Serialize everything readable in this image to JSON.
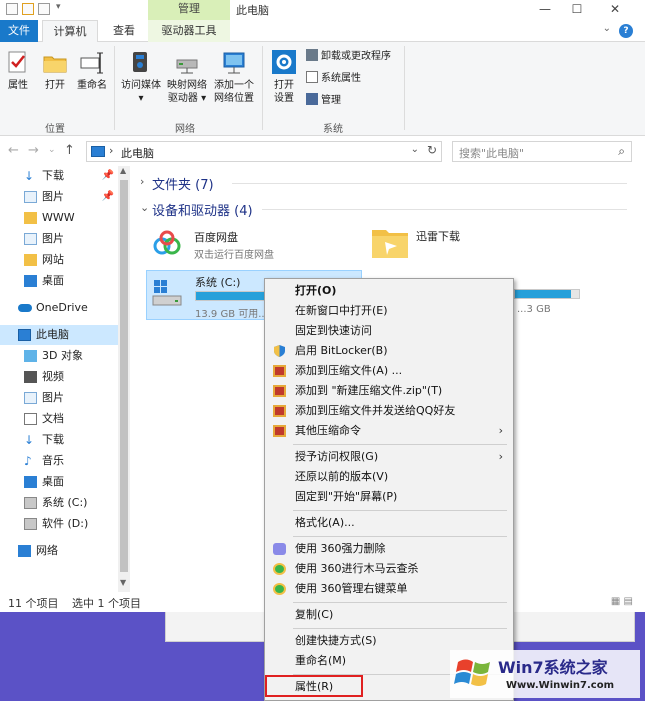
{
  "window": {
    "context_group": "管理",
    "title": "此电脑",
    "minimize": "—",
    "maximize": "☐",
    "close": "✕"
  },
  "tabs": {
    "file": "文件",
    "computer": "计算机",
    "view": "查看",
    "drive_tools": "驱动器工具",
    "help": "?"
  },
  "ribbon": {
    "location": {
      "label": "位置",
      "properties": "属性",
      "open": "打开",
      "rename": "重命名"
    },
    "network": {
      "label": "网络",
      "access_media_1": "访问媒体",
      "access_media_2": "▾",
      "map_drive_1": "映射网络",
      "map_drive_2": "驱动器 ▾",
      "add_location_1": "添加一个",
      "add_location_2": "网络位置"
    },
    "system": {
      "label": "系统",
      "open_settings_1": "打开",
      "open_settings_2": "设置",
      "uninstall": "卸载或更改程序",
      "system_props": "系统属性",
      "manage": "管理"
    }
  },
  "address": {
    "path": "此电脑",
    "search_placeholder": "搜索\"此电脑\""
  },
  "nav": {
    "items": [
      {
        "label": "下载",
        "pinned": true
      },
      {
        "label": "图片",
        "pinned": true
      },
      {
        "label": "WWW",
        "pinned": false
      },
      {
        "label": "图片",
        "pinned": false
      },
      {
        "label": "网站",
        "pinned": false
      },
      {
        "label": "桌面",
        "pinned": false
      },
      {
        "label": "OneDrive",
        "pinned": false
      },
      {
        "label": "此电脑",
        "pinned": false
      },
      {
        "label": "3D 对象",
        "pinned": false
      },
      {
        "label": "视频",
        "pinned": false
      },
      {
        "label": "图片",
        "pinned": false
      },
      {
        "label": "文档",
        "pinned": false
      },
      {
        "label": "下载",
        "pinned": false
      },
      {
        "label": "音乐",
        "pinned": false
      },
      {
        "label": "桌面",
        "pinned": false
      },
      {
        "label": "系统 (C:)",
        "pinned": false
      },
      {
        "label": "软件 (D:)",
        "pinned": false
      },
      {
        "label": "网络",
        "pinned": false
      }
    ]
  },
  "content": {
    "folders_header": "文件夹 (7)",
    "devices_header": "设备和驱动器 (4)",
    "baidu_name": "百度网盘",
    "baidu_sub": "双击运行百度网盘",
    "xunlei_name": "迅雷下载",
    "drive_c_name": "系统 (C:)",
    "drive_c_sub": "13.9 GB 可用...",
    "drive_d_sub": "...3 GB",
    "drive_c_fill_pct": 62,
    "drive_d_fill_pct": 88
  },
  "status": {
    "count": "11 个项目",
    "selected": "选中 1 个项目"
  },
  "context_menu": {
    "open": "打开(O)",
    "open_new_window": "在新窗口中打开(E)",
    "pin_quick": "固定到快速访问",
    "bitlocker": "启用 BitLocker(B)",
    "add_archive": "添加到压缩文件(A) ...",
    "add_zip": "添加到 \"新建压缩文件.zip\"(T)",
    "add_send_qq": "添加到压缩文件并发送给QQ好友",
    "other_compress": "其他压缩命令",
    "grant_access": "授予访问权限(G)",
    "restore": "还原以前的版本(V)",
    "pin_start": "固定到\"开始\"屏幕(P)",
    "format": "格式化(A)...",
    "delete_360": "使用 360强力删除",
    "scan_360": "使用 360进行木马云查杀",
    "manage_360": "使用 360管理右键菜单",
    "copy": "复制(C)",
    "shortcut": "创建快捷方式(S)",
    "rename": "重命名(M)",
    "properties": "属性(R)",
    "submenu_arrow": "›"
  },
  "logo": {
    "text": "Win7系统之家",
    "url": "Www.Winwin7.com"
  },
  "colors": {
    "accent": "#1979ca",
    "drive_bar": "#26a0da",
    "desktop": "#5b52c6",
    "highlight_box": "#e02020"
  }
}
